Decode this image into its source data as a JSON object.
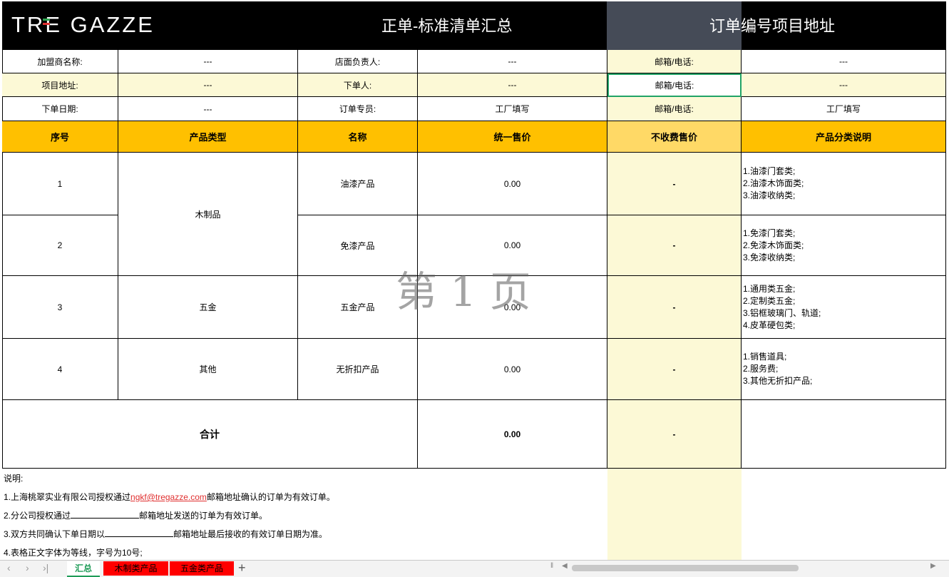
{
  "header": {
    "logo": "TRE GAZZE",
    "title": "正单-标准清单汇总",
    "project_title": "订单编号项目地址"
  },
  "info_rows": [
    {
      "label1": "加盟商名称:",
      "value1": "---",
      "label2": "店面负责人:",
      "value2": "---",
      "label3": "邮箱/电话:",
      "value3": "---"
    },
    {
      "label1": "项目地址:",
      "value1": "---",
      "label2": "下单人:",
      "value2": "---",
      "label3": "邮箱/电话:",
      "value3": "---"
    },
    {
      "label1": "下单日期:",
      "value1": "---",
      "label2": "订单专员:",
      "value2": "工厂填写",
      "label3": "邮箱/电话:",
      "value3": "工厂填写"
    }
  ],
  "table_header": {
    "seq": "序号",
    "type": "产品类型",
    "name": "名称",
    "price": "统一售价",
    "nocharge": "不收费售价",
    "desc": "产品分类说明"
  },
  "rows": [
    {
      "seq": "1",
      "name": "油漆产品",
      "price": "0.00",
      "nocharge": "-",
      "desc": [
        "1.油漆门套类;",
        "2.油漆木饰面类;",
        "3.油漆收纳类;"
      ]
    },
    {
      "seq": "2",
      "name": "免漆产品",
      "price": "0.00",
      "nocharge": "-",
      "desc": [
        "1.免漆门套类;",
        "2.免漆木饰面类;",
        "3.免漆收纳类;"
      ]
    },
    {
      "seq": "3",
      "name": "五金产品",
      "price": "0.00",
      "nocharge": "-",
      "desc": [
        "1.通用类五金;",
        "2.定制类五金;",
        "3.铝框玻璃门、轨道;",
        "4.皮革硬包类;"
      ]
    },
    {
      "seq": "4",
      "name": "无折扣产品",
      "price": "0.00",
      "nocharge": "-",
      "desc": [
        "1.销售道具;",
        "2.服务费;",
        "3.其他无折扣产品;"
      ]
    }
  ],
  "types": {
    "wood": "木制品",
    "hardware": "五金",
    "other": "其他"
  },
  "total": {
    "label": "合计",
    "price": "0.00",
    "nocharge": "-"
  },
  "watermark": "第 1 页",
  "notes": {
    "title": "说明:",
    "n1_pre": "1.上海桃翠实业有限公司授权通过",
    "n1_email": "ngkf@tregazze.com",
    "n1_post": "邮箱地址确认的订单为有效订单。",
    "n2_pre": "2.分公司授权通过",
    "n2_post": "邮箱地址发送的订单为有效订单。",
    "n3_pre": "3.双方共同确认下单日期以",
    "n3_post": "邮箱地址最后接收的有效订单日期为准。",
    "n4": "4.表格正文字体为等线，字号为10号;"
  },
  "sheet_tabs": [
    {
      "label": "汇总",
      "active": true
    },
    {
      "label": "木制类产品",
      "active": false
    },
    {
      "label": "五金类产品",
      "active": false
    }
  ],
  "colors": {
    "header_bg": "#000000",
    "orange": "#ffc000",
    "light_yellow": "#fcf9d6",
    "tab_red": "#ff0000",
    "active_tab": "#1e9b57"
  }
}
